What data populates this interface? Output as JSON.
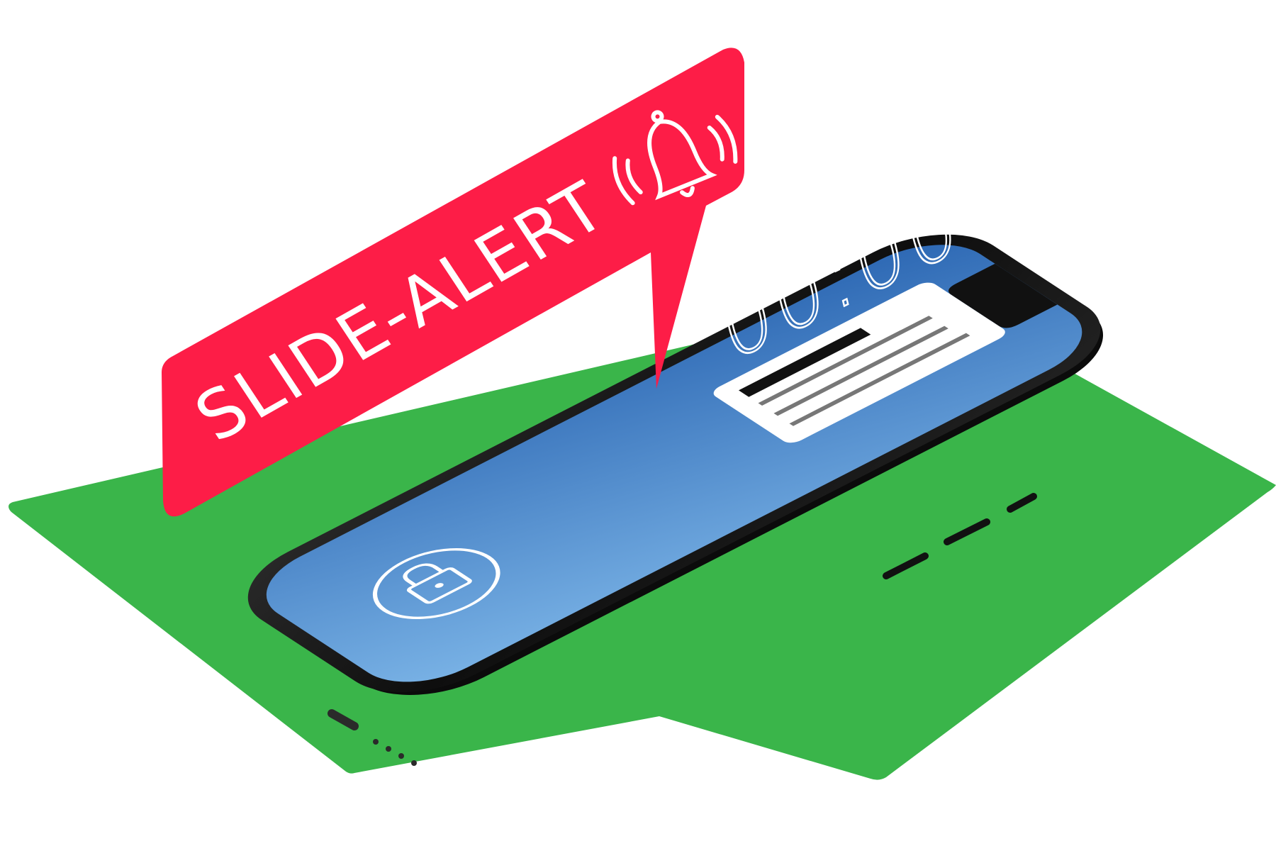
{
  "banner": {
    "label": "SLIDE-ALERT",
    "icon": "ringing-bell-icon"
  },
  "phone": {
    "clock": "00:00",
    "notification_icon": "notification-card",
    "unlock_icon": "padlock-icon"
  },
  "colors": {
    "background": "#ffffff",
    "platform": "#3ab54a",
    "banner": "#fd1d47",
    "screen_top": "#2f6db8",
    "screen_bottom": "#78aee3",
    "phone_body": "#141414"
  }
}
